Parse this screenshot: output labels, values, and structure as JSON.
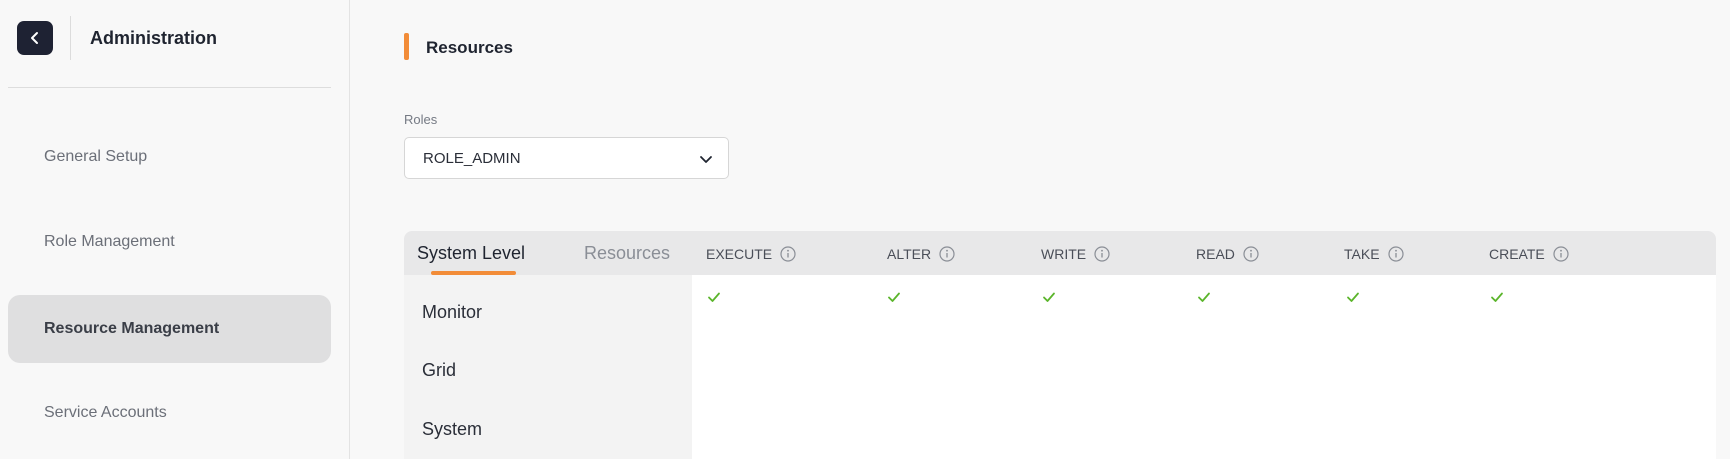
{
  "sidebar": {
    "title": "Administration",
    "back_icon": "chevron-left-icon",
    "items": [
      {
        "label": "General Setup",
        "active": false
      },
      {
        "label": "Role Management",
        "active": false
      },
      {
        "label": "Resource Management",
        "active": true
      },
      {
        "label": "Service Accounts",
        "active": false
      }
    ]
  },
  "main": {
    "section_title": "Resources",
    "roles": {
      "label": "Roles",
      "selected": "ROLE_ADMIN"
    },
    "tabs": [
      {
        "label": "System Level",
        "active": true
      },
      {
        "label": "Resources",
        "active": false
      }
    ],
    "columns": [
      {
        "label": "EXECUTE"
      },
      {
        "label": "ALTER"
      },
      {
        "label": "WRITE"
      },
      {
        "label": "READ"
      },
      {
        "label": "TAKE"
      },
      {
        "label": "CREATE"
      }
    ],
    "resources": [
      "Monitor",
      "Grid",
      "System"
    ],
    "first_row_checks": [
      true,
      true,
      true,
      true,
      true,
      true
    ]
  },
  "colors": {
    "accent": "#f28c38",
    "check": "#5bb52b",
    "back_button": "#1e2233"
  }
}
